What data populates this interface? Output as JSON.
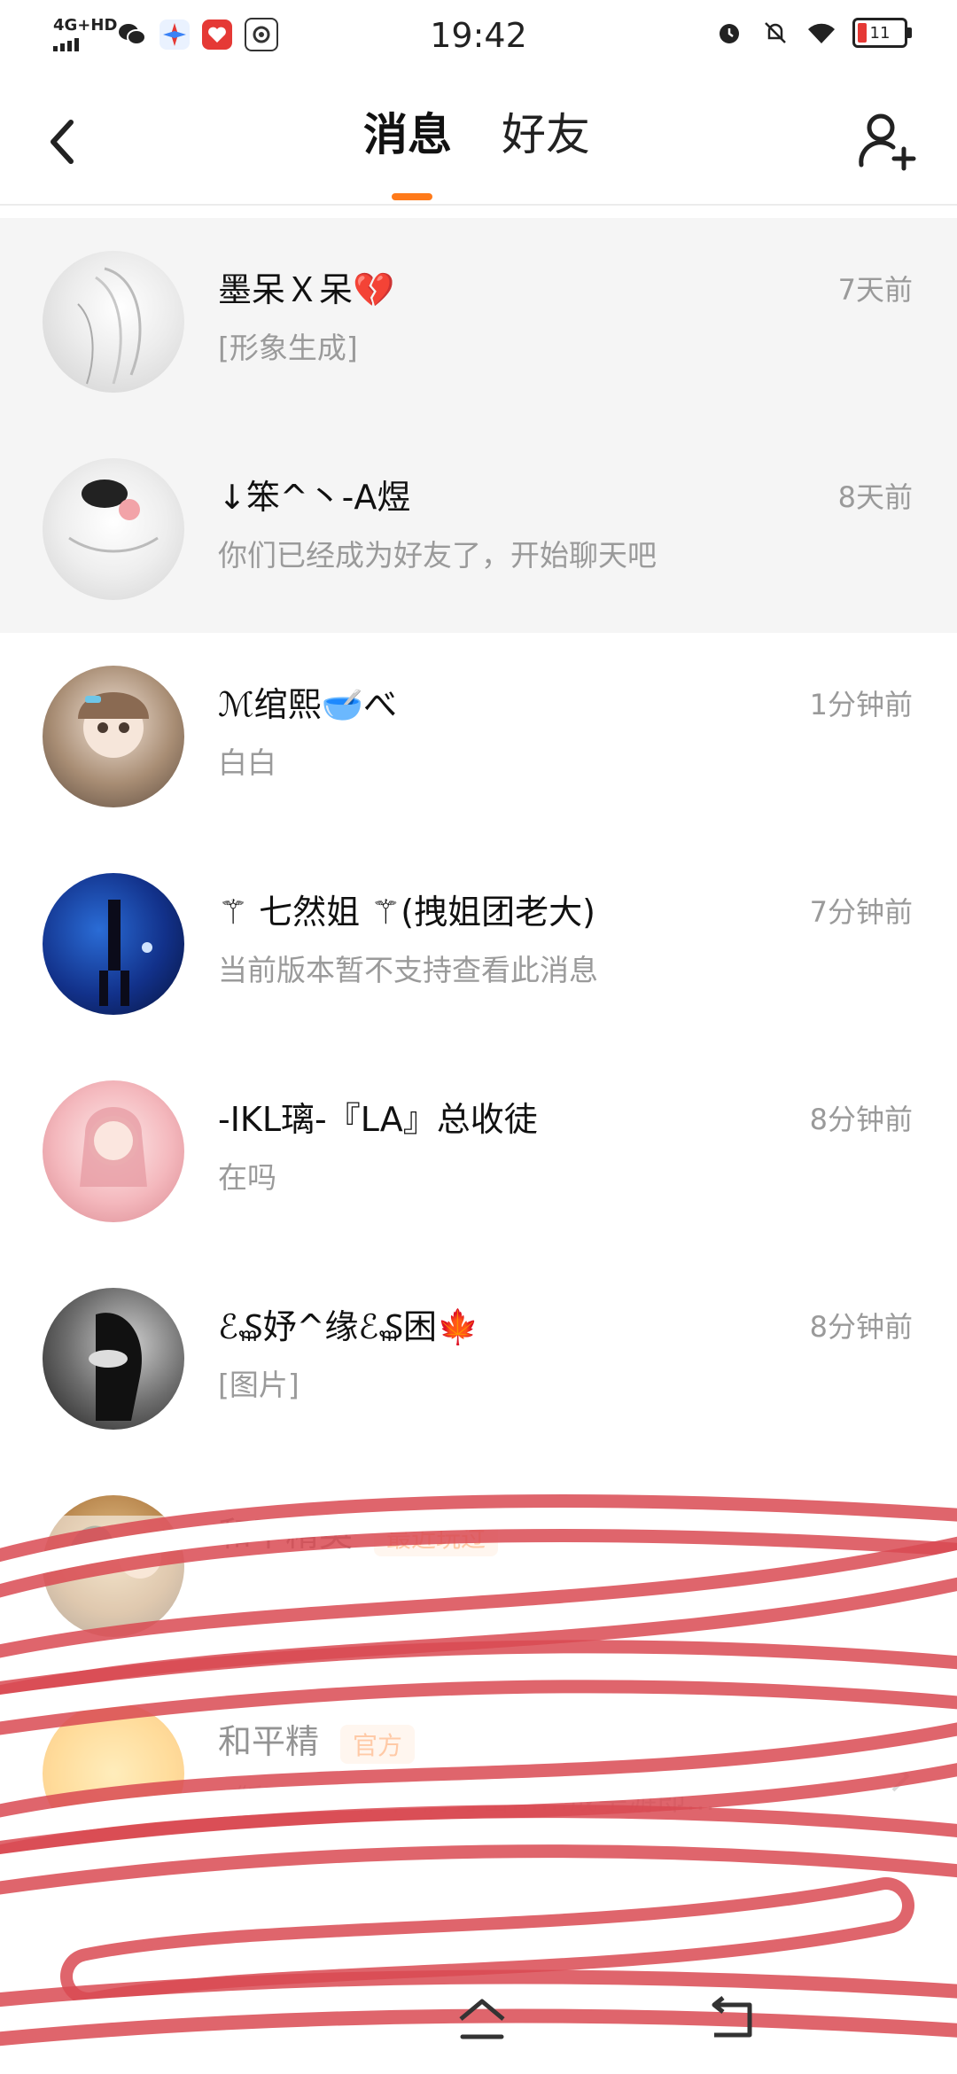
{
  "status_bar": {
    "network": "4G+HD",
    "time": "19:42",
    "battery": "11",
    "icons": [
      "wechat-icon",
      "browser-icon",
      "red-app-icon",
      "qq-icon"
    ],
    "right_icons": [
      "alarm-icon",
      "mute-icon",
      "wifi-icon"
    ]
  },
  "header": {
    "tabs": [
      "消息",
      "好友"
    ],
    "active_tab": "消息",
    "accent_color": "#ff7a1a"
  },
  "conversations": [
    {
      "name": "墨呆Ｘ呆",
      "emoji": "💔",
      "preview": "[形象生成]",
      "time": "7天前",
      "pinned": true
    },
    {
      "name": "↓笨^丶-A煜",
      "emoji": "",
      "preview": "你们已经成为好友了，开始聊天吧",
      "time": "8天前",
      "pinned": true
    },
    {
      "name": "ℳ绾熙",
      "emoji": "🥣",
      "name_suffix": "べ",
      "preview": "白白",
      "time": "1分钟前",
      "pinned": false
    },
    {
      "name": "⚚ 七然姐 ⚚(拽姐团老大)",
      "emoji": "",
      "preview": "当前版本暂不支持查看此消息",
      "time": "7分钟前",
      "pinned": false
    },
    {
      "name": "-IKL璃-『LA』总收徒",
      "emoji": "",
      "preview": "在吗",
      "time": "8分钟前",
      "pinned": false
    },
    {
      "name": "ℰ₷妤^缘ℰ₷困",
      "emoji": "🍁",
      "preview": "[图片]",
      "time": "8分钟前",
      "pinned": false
    },
    {
      "name": "和平精英",
      "tag": "最近玩过",
      "preview": "",
      "time": "",
      "pinned": false
    },
    {
      "name": "和平精",
      "tag": "官方",
      "preview": "《和平精英》严厉打击……成手游即…",
      "time": "",
      "pinned": false
    }
  ],
  "colors": {
    "pinned_bg": "#f5f5f5",
    "muted_text": "#9a9a9a",
    "scribble": "#d94a52"
  }
}
